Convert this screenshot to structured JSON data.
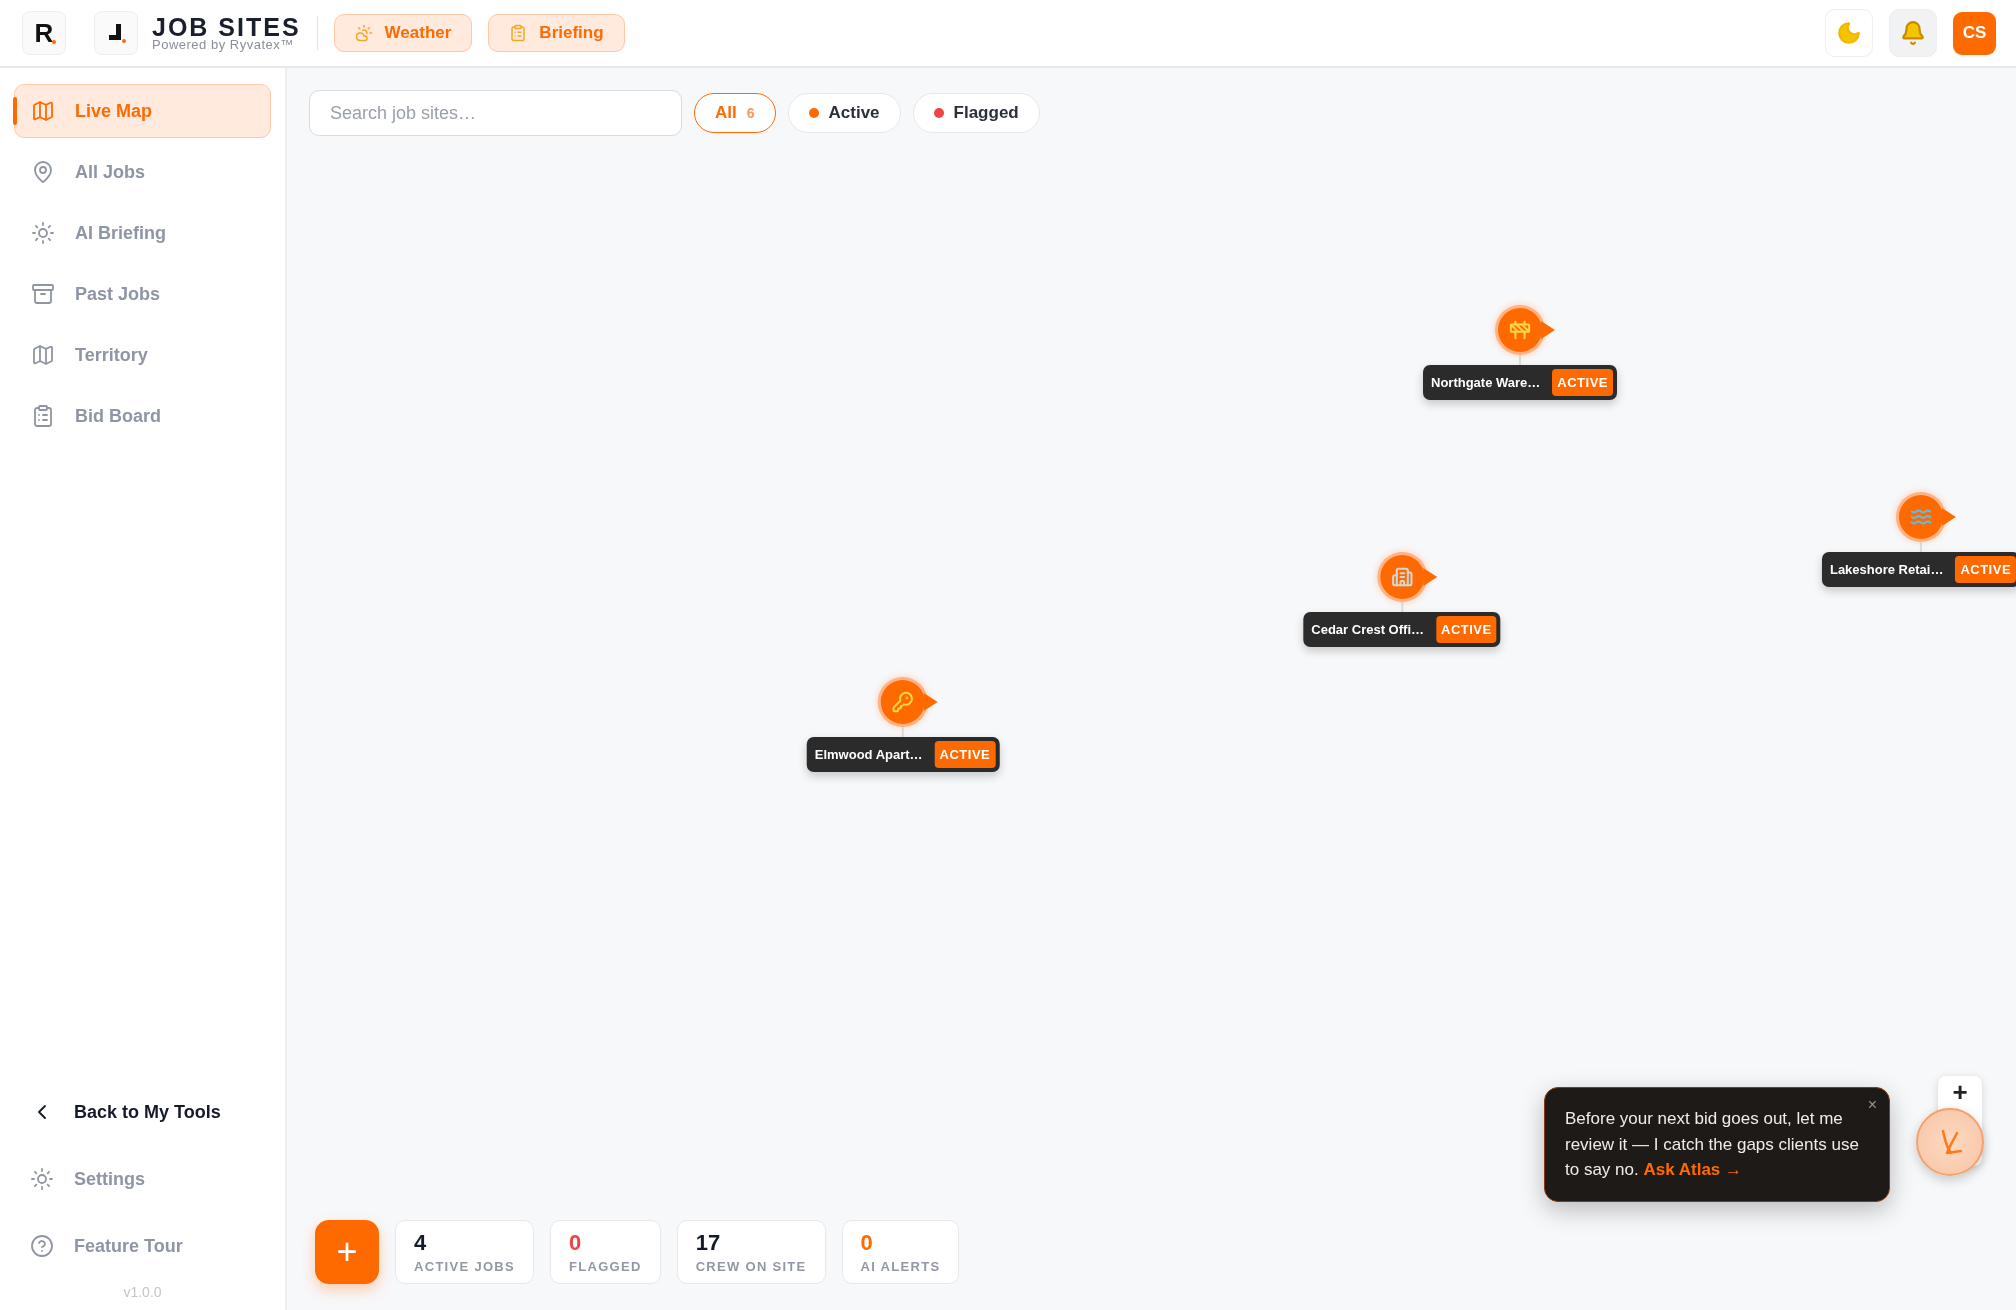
{
  "header": {
    "logo_letter": "R",
    "title": "JOB SITES",
    "subtitle": "Powered by Ryvatex™",
    "buttons": [
      {
        "label": "Weather",
        "kind": "weather"
      },
      {
        "label": "Briefing",
        "kind": "briefing"
      }
    ],
    "user_initials": "CS"
  },
  "sidebar": {
    "items": [
      {
        "label": "Live Map",
        "selected": true
      },
      {
        "label": "All Jobs",
        "selected": false
      },
      {
        "label": "AI Briefing",
        "selected": false
      },
      {
        "label": "Past Jobs",
        "selected": false
      },
      {
        "label": "Territory",
        "selected": false
      },
      {
        "label": "Bid Board",
        "selected": false
      }
    ],
    "footer_items": [
      {
        "label": "Back to My Tools",
        "kind": "back"
      },
      {
        "label": "Settings",
        "kind": "settings"
      },
      {
        "label": "Feature Tour",
        "kind": "help"
      }
    ],
    "version": "v1.0.0"
  },
  "search": {
    "placeholder": "Search job sites…"
  },
  "filters": [
    {
      "label": "All",
      "count": "6",
      "selected": true
    },
    {
      "label": "Active",
      "color": "#ff6a00",
      "selected": false
    },
    {
      "label": "Flagged",
      "color": "#ef4444",
      "selected": false
    }
  ],
  "markers": [
    {
      "name": "Northgate Ware…",
      "status": "ACTIVE"
    },
    {
      "name": "Lakeshore Retai…",
      "status": "ACTIVE"
    },
    {
      "name": "Cedar Crest Offi…",
      "status": "ACTIVE"
    },
    {
      "name": "Elmwood Apart…",
      "status": "ACTIVE"
    }
  ],
  "add_button": "+",
  "stats": [
    {
      "value": "4",
      "label": "ACTIVE JOBS",
      "color": "#141a2a"
    },
    {
      "value": "0",
      "label": "FLAGGED",
      "color": "#ef4444"
    },
    {
      "value": "17",
      "label": "CREW ON SITE",
      "color": "#141a2a"
    },
    {
      "value": "0",
      "label": "AI ALERTS",
      "color": "#ff6a00"
    }
  ],
  "atlas_tip": {
    "text": "Before your next bid goes out, let me review it — I catch the gaps clients use to say no.",
    "link": "Ask Atlas →",
    "close": "×"
  },
  "zoom_in": "+"
}
